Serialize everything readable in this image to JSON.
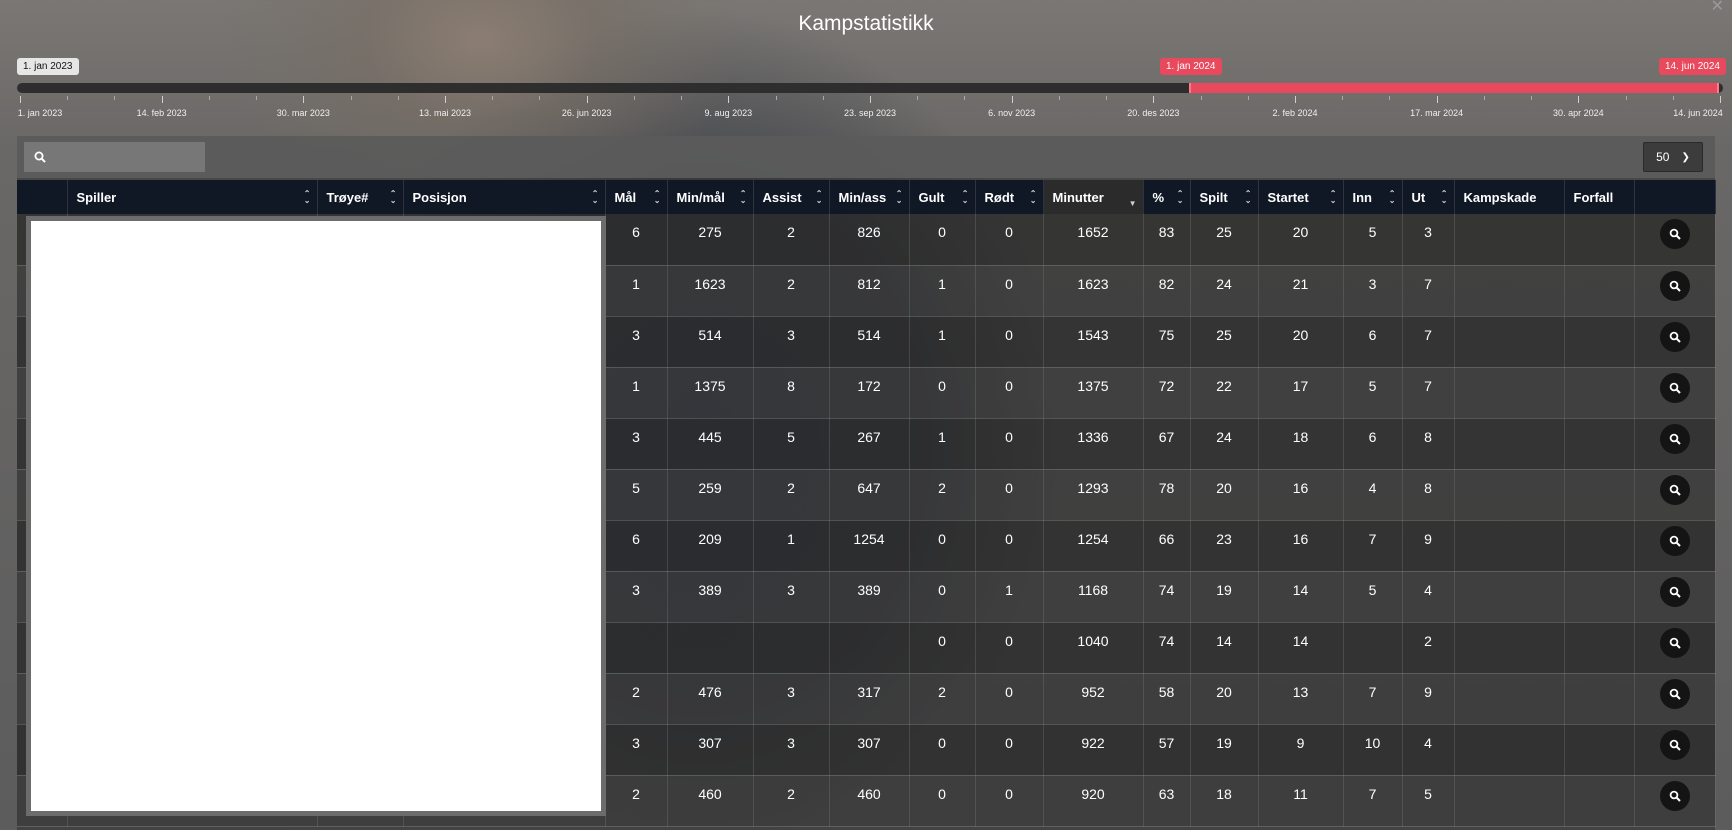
{
  "title": "Kampstatistikk",
  "close_icon": "close-icon",
  "slider": {
    "min_label": "1. jan 2023",
    "from_label": "1. jan 2024",
    "to_label": "14. jun 2024",
    "selected_range_fraction": [
      0.687,
      1.0
    ],
    "accent_color": "#e8495d",
    "tick_labels": [
      "1. jan 2023",
      "14. feb 2023",
      "30. mar 2023",
      "13. mai 2023",
      "26. jun 2023",
      "9. aug 2023",
      "23. sep 2023",
      "6. nov 2023",
      "20. des 2023",
      "2. feb 2024",
      "17. mar 2024",
      "30. apr 2024",
      "14. jun 2024"
    ]
  },
  "toolbar": {
    "search_icon": "search-icon",
    "search_value": "",
    "page_size": "50"
  },
  "table": {
    "headers": [
      "",
      "Spiller",
      "Trøye#",
      "Posisjon",
      "Mål",
      "Min/mål",
      "Assist",
      "Min/ass",
      "Gult",
      "Rødt",
      "Minutter",
      "%",
      "Spilt",
      "Startet",
      "Inn",
      "Ut",
      "Kampskade",
      "Forfall",
      ""
    ],
    "sortable": [
      false,
      true,
      true,
      true,
      true,
      true,
      true,
      true,
      true,
      true,
      true,
      true,
      true,
      true,
      true,
      true,
      false,
      false,
      false
    ],
    "active_sort": "Minutter",
    "rows": [
      [
        "6",
        "275",
        "2",
        "826",
        "0",
        "0",
        "1652",
        "83",
        "25",
        "20",
        "5",
        "3"
      ],
      [
        "1",
        "1623",
        "2",
        "812",
        "1",
        "0",
        "1623",
        "82",
        "24",
        "21",
        "3",
        "7"
      ],
      [
        "3",
        "514",
        "3",
        "514",
        "1",
        "0",
        "1543",
        "75",
        "25",
        "20",
        "6",
        "7"
      ],
      [
        "1",
        "1375",
        "8",
        "172",
        "0",
        "0",
        "1375",
        "72",
        "22",
        "17",
        "5",
        "7"
      ],
      [
        "3",
        "445",
        "5",
        "267",
        "1",
        "0",
        "1336",
        "67",
        "24",
        "18",
        "6",
        "8"
      ],
      [
        "5",
        "259",
        "2",
        "647",
        "2",
        "0",
        "1293",
        "78",
        "20",
        "16",
        "4",
        "8"
      ],
      [
        "6",
        "209",
        "1",
        "1254",
        "0",
        "0",
        "1254",
        "66",
        "23",
        "16",
        "7",
        "9"
      ],
      [
        "3",
        "389",
        "3",
        "389",
        "0",
        "1",
        "1168",
        "74",
        "19",
        "14",
        "5",
        "4"
      ],
      [
        "",
        "",
        "",
        "",
        "0",
        "0",
        "1040",
        "74",
        "14",
        "14",
        "",
        "2"
      ],
      [
        "2",
        "476",
        "3",
        "317",
        "2",
        "0",
        "952",
        "58",
        "20",
        "13",
        "7",
        "9"
      ],
      [
        "3",
        "307",
        "3",
        "307",
        "0",
        "0",
        "922",
        "57",
        "19",
        "9",
        "10",
        "4"
      ],
      [
        "2",
        "460",
        "2",
        "460",
        "0",
        "0",
        "920",
        "63",
        "18",
        "11",
        "7",
        "5"
      ]
    ],
    "row_action_icon": "magnifier-icon"
  }
}
